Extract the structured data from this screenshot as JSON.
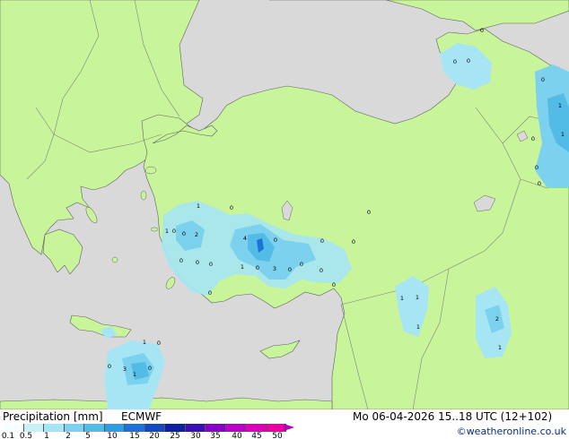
{
  "header": {
    "title": "Precipitation [mm]",
    "model": "ECMWF",
    "valid_time": "Mo 06-04-2026 15..18 UTC (12+102)",
    "copyright": "©weatheronline.co.uk"
  },
  "legend": {
    "ticks": [
      "0.1",
      "0.5",
      "1",
      "2",
      "5",
      "10",
      "15",
      "20",
      "25",
      "30",
      "35",
      "40",
      "45",
      "50"
    ],
    "colors": [
      "#f6ffff",
      "#c8f2f8",
      "#a6e6f4",
      "#7cd2ee",
      "#52bce6",
      "#2e9ee0",
      "#1c72d8",
      "#1848c0",
      "#1020a0",
      "#3a10b0",
      "#8800c8",
      "#b800c8",
      "#d800b8",
      "#e800a0"
    ]
  },
  "map": {
    "colors": {
      "land": "#c8f59a",
      "land_outside_domain": "#d9d9d9",
      "sea": "#d9d9d9",
      "border": "#808080",
      "coast": "#606060"
    },
    "point_values": [
      {
        "label": "0"
      },
      {
        "label": "0"
      },
      {
        "label": "0"
      },
      {
        "label": "0"
      },
      {
        "label": "1"
      },
      {
        "label": "0"
      },
      {
        "label": "1"
      },
      {
        "label": "0"
      },
      {
        "label": "0"
      },
      {
        "label": "1"
      },
      {
        "label": "0"
      },
      {
        "label": "0"
      },
      {
        "label": "2"
      },
      {
        "label": "0"
      },
      {
        "label": "0"
      },
      {
        "label": "1"
      },
      {
        "label": "4"
      },
      {
        "label": "0"
      },
      {
        "label": "0"
      },
      {
        "label": "0"
      },
      {
        "label": "0"
      },
      {
        "label": "0"
      },
      {
        "label": "0"
      },
      {
        "label": "0"
      },
      {
        "label": "1"
      },
      {
        "label": "0"
      },
      {
        "label": "3"
      },
      {
        "label": "0"
      },
      {
        "label": "0"
      },
      {
        "label": "0"
      },
      {
        "label": "0"
      },
      {
        "label": "1"
      },
      {
        "label": "1"
      },
      {
        "label": "2"
      },
      {
        "label": "1"
      },
      {
        "label": "1"
      },
      {
        "label": "0"
      },
      {
        "label": "1"
      },
      {
        "label": "3"
      },
      {
        "label": "1"
      },
      {
        "label": "0"
      },
      {
        "label": "0"
      }
    ]
  }
}
